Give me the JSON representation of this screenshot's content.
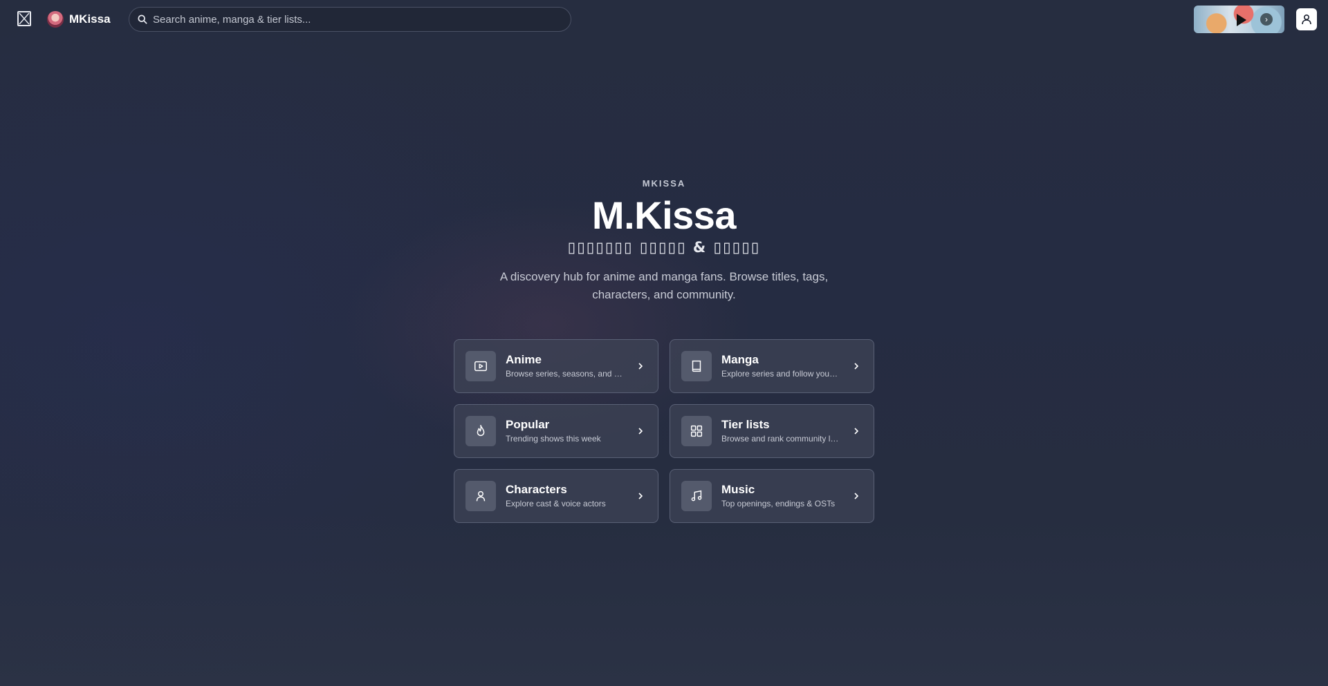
{
  "header": {
    "brand_name": "MKissa",
    "search_placeholder": "Search anime, manga & tier lists...",
    "icons": [
      "menu-icon",
      "search-icon",
      "play-icon",
      "chevron-right-icon",
      "user-icon"
    ]
  },
  "hero": {
    "eyebrow": "MKISSA",
    "title": "M.Kissa",
    "subtitle": "▯▯▯▯▯▯▯ ▯▯▯▯▯ & ▯▯▯▯▯",
    "description": "A discovery hub for anime and manga fans. Browse titles, tags, characters, and community."
  },
  "cards": [
    {
      "title": "Anime",
      "subtitle": "Browse series, seasons, and more",
      "icon": "play-video-icon"
    },
    {
      "title": "Manga",
      "subtitle": "Explore series and follow your favorites",
      "icon": "book-icon"
    },
    {
      "title": "Popular",
      "subtitle": "Trending shows this week",
      "icon": "flame-icon"
    },
    {
      "title": "Tier lists",
      "subtitle": "Browse and rank community lists",
      "icon": "grid-icon"
    },
    {
      "title": "Characters",
      "subtitle": "Explore cast & voice actors",
      "icon": "person-icon"
    },
    {
      "title": "Music",
      "subtitle": "Top openings, endings & OSTs",
      "icon": "music-icon"
    }
  ],
  "colors": {
    "background": "#262d40",
    "card_background": "#3e4456",
    "card_border": "#5a6176",
    "text_primary": "#ffffff",
    "text_secondary": "#c9ccd6"
  }
}
